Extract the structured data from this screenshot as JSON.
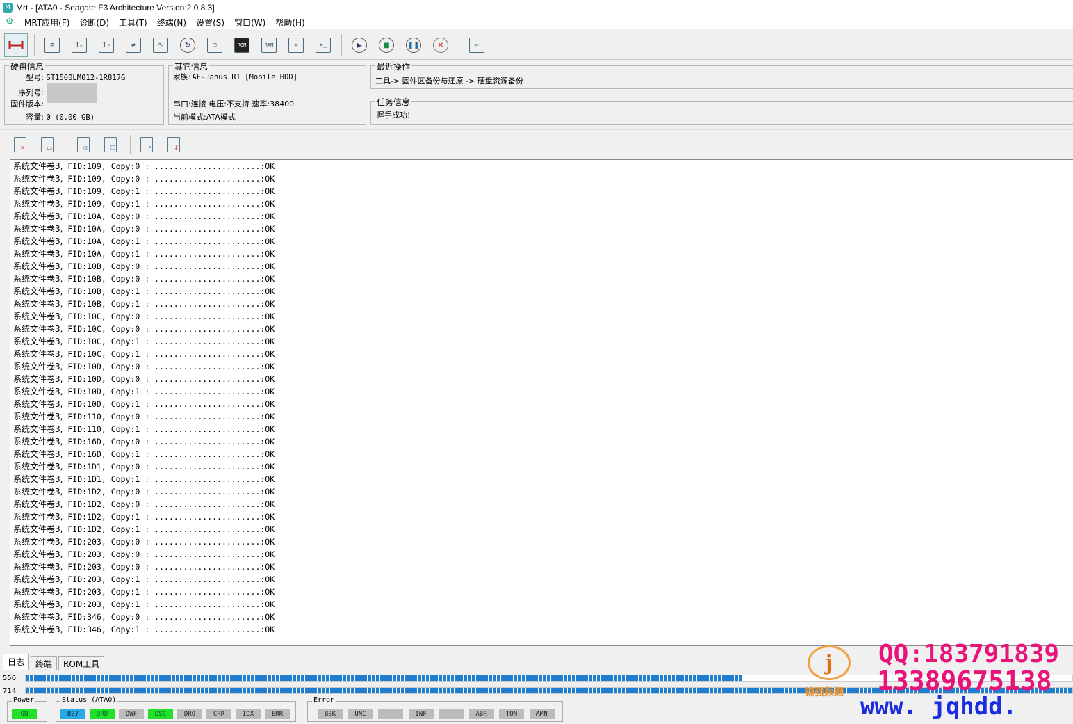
{
  "window": {
    "title": "Mrt - [ATA0 - Seagate F3 Architecture Version:2.0.8.3]"
  },
  "menu": [
    "MRT应用(F)",
    "诊断(D)",
    "工具(T)",
    "终端(N)",
    "设置(S)",
    "窗口(W)",
    "帮助(H)"
  ],
  "toolbar": {
    "rom_label": "ROM",
    "ram_label": "RAM"
  },
  "disk_info": {
    "legend": "硬盘信息",
    "model_label": "型号:",
    "model": "ST1500LM012-1R817G",
    "serial_label": "序列号:",
    "serial": "",
    "firmware_label": "固件版本:",
    "firmware": "",
    "capacity_label": "容量:",
    "capacity": "0 (0.00 GB)"
  },
  "other_info": {
    "legend": "其它信息",
    "family": "家族:AF-Janus_R1 [Mobile HDD]",
    "port": "串口:连接 电压:不支持 速率:38400",
    "mode": "当前模式:ATA模式"
  },
  "recent_ops": {
    "legend": "最近操作",
    "text": "工具-> 固件区备份与还原 -> 硬盘资源备份"
  },
  "task_info": {
    "legend": "任务信息",
    "text": "握手成功!"
  },
  "log": {
    "prefix": "系统文件卷3,",
    "dots": "......................",
    "status": ":OK",
    "lines": [
      {
        "fid": "109",
        "copy": "0"
      },
      {
        "fid": "109",
        "copy": "0"
      },
      {
        "fid": "109",
        "copy": "1"
      },
      {
        "fid": "109",
        "copy": "1"
      },
      {
        "fid": "10A",
        "copy": "0"
      },
      {
        "fid": "10A",
        "copy": "0"
      },
      {
        "fid": "10A",
        "copy": "1"
      },
      {
        "fid": "10A",
        "copy": "1"
      },
      {
        "fid": "10B",
        "copy": "0"
      },
      {
        "fid": "10B",
        "copy": "0"
      },
      {
        "fid": "10B",
        "copy": "1"
      },
      {
        "fid": "10B",
        "copy": "1"
      },
      {
        "fid": "10C",
        "copy": "0"
      },
      {
        "fid": "10C",
        "copy": "0"
      },
      {
        "fid": "10C",
        "copy": "1"
      },
      {
        "fid": "10C",
        "copy": "1"
      },
      {
        "fid": "10D",
        "copy": "0"
      },
      {
        "fid": "10D",
        "copy": "0"
      },
      {
        "fid": "10D",
        "copy": "1"
      },
      {
        "fid": "10D",
        "copy": "1"
      },
      {
        "fid": "110",
        "copy": "0"
      },
      {
        "fid": "110",
        "copy": "1"
      },
      {
        "fid": "16D",
        "copy": "0"
      },
      {
        "fid": "16D",
        "copy": "1"
      },
      {
        "fid": "1D1",
        "copy": "0"
      },
      {
        "fid": "1D1",
        "copy": "1"
      },
      {
        "fid": "1D2",
        "copy": "0"
      },
      {
        "fid": "1D2",
        "copy": "0"
      },
      {
        "fid": "1D2",
        "copy": "1"
      },
      {
        "fid": "1D2",
        "copy": "1"
      },
      {
        "fid": "203",
        "copy": "0"
      },
      {
        "fid": "203",
        "copy": "0"
      },
      {
        "fid": "203",
        "copy": "0"
      },
      {
        "fid": "203",
        "copy": "1"
      },
      {
        "fid": "203",
        "copy": "1"
      },
      {
        "fid": "203",
        "copy": "1"
      },
      {
        "fid": "346",
        "copy": "0"
      },
      {
        "fid": "346",
        "copy": "1"
      }
    ]
  },
  "tabs": [
    "日志",
    "终端",
    "ROM工具"
  ],
  "progress": [
    {
      "label": "550",
      "fraction": 0.685
    },
    {
      "label": "714",
      "fraction": 1.0
    }
  ],
  "status": {
    "power_legend": "Power",
    "power_on": "ON",
    "status_legend": "Status (ATA0)",
    "status_leds": [
      {
        "label": "BSY",
        "state": "blue"
      },
      {
        "label": "DRD",
        "state": "green"
      },
      {
        "label": "DWF",
        "state": "off"
      },
      {
        "label": "DSC",
        "state": "green"
      },
      {
        "label": "DRQ",
        "state": "off"
      },
      {
        "label": "CRR",
        "state": "off"
      },
      {
        "label": "IDX",
        "state": "off"
      },
      {
        "label": "ERR",
        "state": "off"
      }
    ],
    "error_legend": "Error",
    "error_leds": [
      "BBK",
      "UNC",
      "",
      "INF",
      "",
      "ABR",
      "TON",
      "AMN"
    ]
  },
  "watermark": {
    "qq": "QQ:183791839",
    "phone": "13389675138",
    "site": "www. jqhdd. com",
    "brand": "锦强数据",
    "colors": {
      "text": "#e8147a",
      "site": "#1a2ee0"
    }
  }
}
